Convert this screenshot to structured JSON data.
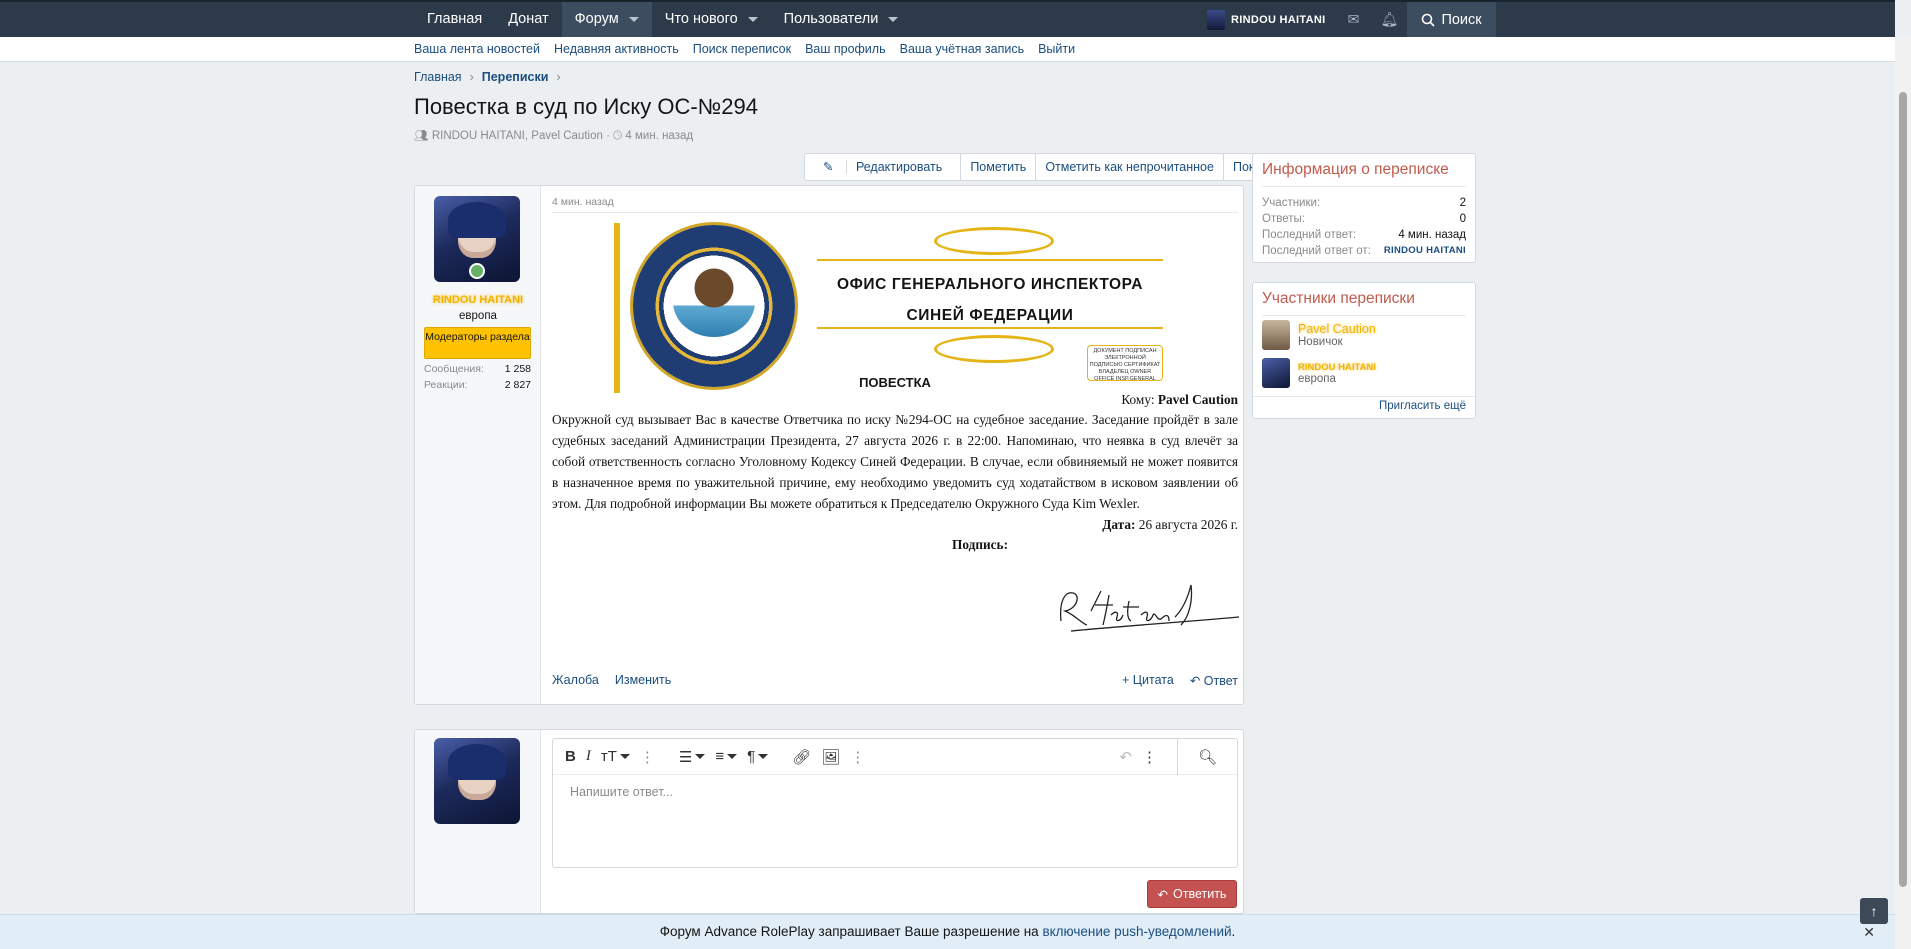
{
  "nav": {
    "items": [
      "Главная",
      "Донат",
      "Форум",
      "Что нового",
      "Пользователи"
    ],
    "user": "RINDOU HAITANI",
    "search": "Поиск"
  },
  "subnav": [
    "Ваша лента новостей",
    "Недавняя активность",
    "Поиск переписок",
    "Ваш профиль",
    "Ваша учётная запись",
    "Выйти"
  ],
  "breadcrumb": [
    "Главная",
    "Переписки"
  ],
  "thread": {
    "title": "Повестка в суд по Иску ОС-№294",
    "participants": "RINDOU HAITANI, Pavel Caution",
    "time": "4 мин. назад"
  },
  "actions": [
    "Редактировать",
    "Пометить",
    "Отметить как непрочитанное",
    "Покинуть"
  ],
  "post": {
    "time": "4 мин. назад",
    "author": "RINDOU HAITANI",
    "location": "европа",
    "banner": "Модераторы раздела",
    "stats": [
      {
        "label": "Сообщения:",
        "value": "1 258"
      },
      {
        "label": "Реакции:",
        "value": "2 827"
      }
    ],
    "office_title_1": "ОФИС ГЕНЕРАЛЬНОГО ИНСПЕКТОРА",
    "office_title_2": "СИНЕЙ ФЕДЕРАЦИИ",
    "stamp": "ДОКУМЕНТ ПОДПИСАН ЭЛЕКТРОННОЙ ПОДПИСЬЮ СЕРТИФИКАТ ВЛАДЕЛЕЦ OWNER OFFICE INSP.GENERAL",
    "heading": "ПОВЕСТКА",
    "to_label": "Кому:",
    "to_name": "Pavel Caution",
    "body": "Окружной суд вызывает Вас в качестве Ответчика по иску №294-ОС на судебное заседание. Заседание пройдёт в зале судебных заседаний Администрации Президента, 27 августа 2026 г. в 22:00. Напоминаю, что неявка в суд влечёт за собой ответственность согласно Уголовному Кодексу Синей Федерации. В случае, если обвиняемый не может появится в назначенное время по уважительной причине, ему необходимо уведомить суд ходатайством в исковом заявлении об этом. Для подробной информации Вы можете обратиться к Председателю Окружного Суда Kim Wexler.",
    "date_label": "Дата:",
    "date_value": "26 августа 2026 г.",
    "signature_label": "Подпись:",
    "signature": "R.Haitani",
    "footer_left": [
      "Жалоба",
      "Изменить"
    ],
    "footer_right": [
      "Цитата",
      "Ответ"
    ]
  },
  "sidebar": {
    "info_title": "Информация о переписке",
    "info": [
      {
        "label": "Участники:",
        "value": "2"
      },
      {
        "label": "Ответы:",
        "value": "0"
      },
      {
        "label": "Последний ответ:",
        "value": "4 мин. назад"
      },
      {
        "label": "Последний ответ от:",
        "value": "RINDOU HAITANI"
      }
    ],
    "members_title": "Участники переписки",
    "members": [
      {
        "name": "Pavel Caution",
        "title": "Новичок"
      },
      {
        "name": "RINDOU HAITANI",
        "title": "европа"
      }
    ],
    "invite": "Пригласить ещё"
  },
  "editor": {
    "placeholder": "Напишите ответ...",
    "reply": "Ответить"
  },
  "notice": {
    "text": "Форум Advance RolePlay запрашивает Ваше разрешение на",
    "link": "включение push-уведомлений",
    "end": "."
  }
}
